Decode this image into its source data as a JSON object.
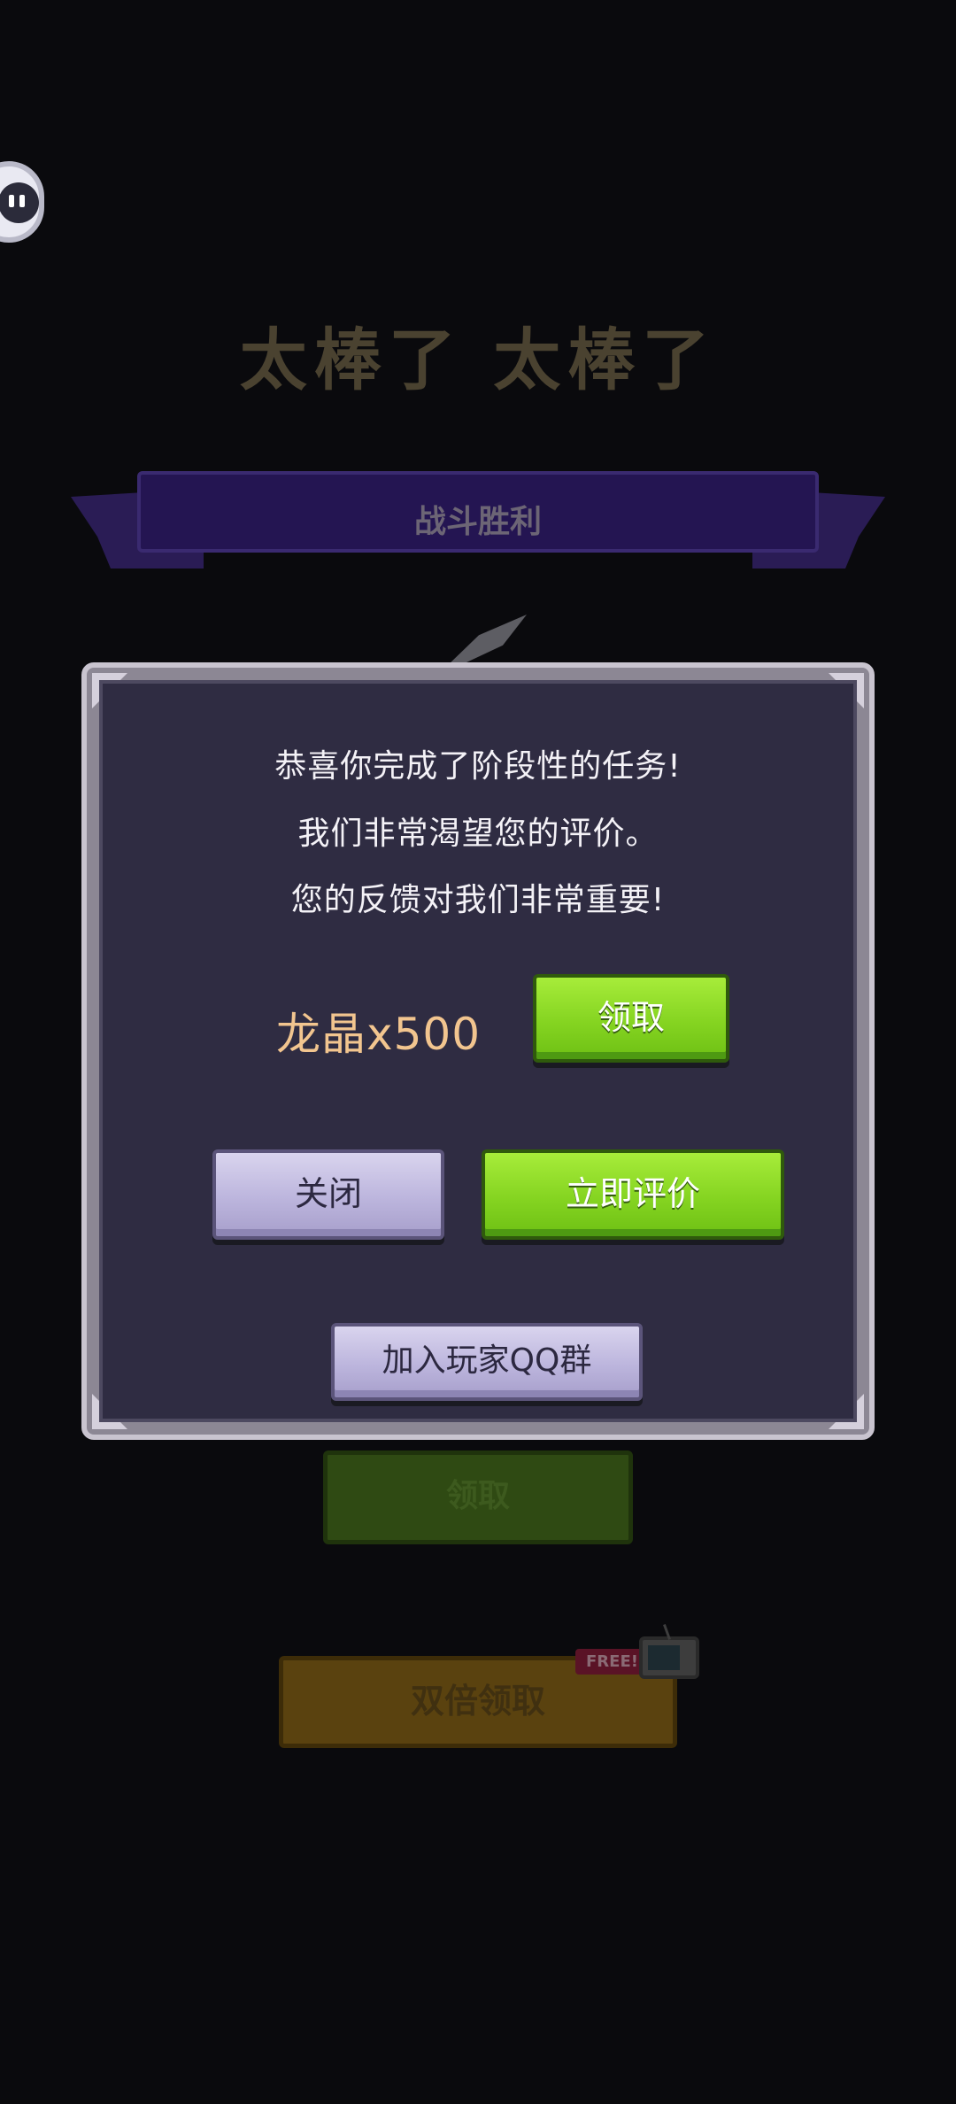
{
  "background": {
    "title": "太棒了 太棒了",
    "ribbon_label": "战斗胜利",
    "claim_button": "领取",
    "double_claim_button": "双倍领取",
    "free_tag": "FREE!"
  },
  "dialog": {
    "message_lines": [
      "恭喜你完成了阶段性的任务!",
      "我们非常渴望您的评价。",
      "您的反馈对我们非常重要!"
    ],
    "reward": "龙晶x500",
    "claim_button": "领取",
    "close_button": "关闭",
    "rate_button": "立即评价",
    "join_group_button": "加入玩家QQ群"
  },
  "colors": {
    "dialog_bg": "#2f2c42",
    "green_button": "#85d421",
    "purple_button": "#bcb5dd",
    "reward_text": "#f2c58f"
  }
}
